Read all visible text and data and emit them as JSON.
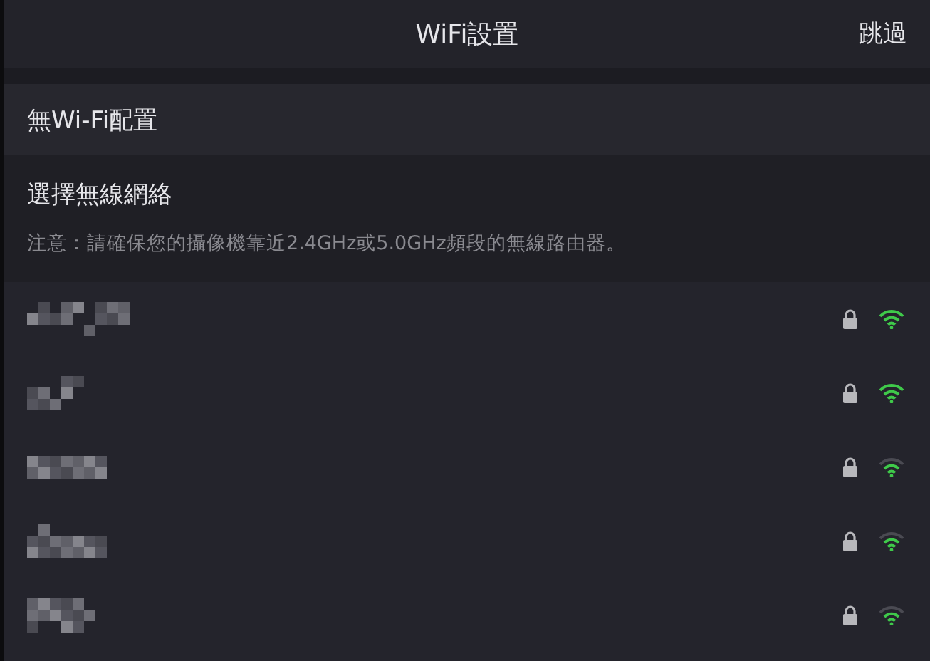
{
  "header": {
    "title": "WiFi設置",
    "skip": "跳過"
  },
  "no_wifi": {
    "label": "無Wi-Fi配置"
  },
  "section": {
    "title": "選擇無線網絡",
    "note": "注意：請確保您的攝像機靠近2.4GHz或5.0GHz頻段的無線路由器。"
  },
  "networks": [
    {
      "locked": true,
      "kind": "full"
    },
    {
      "locked": true,
      "kind": "full"
    },
    {
      "locked": true,
      "kind": "good"
    },
    {
      "locked": true,
      "kind": "good"
    },
    {
      "locked": true,
      "kind": "good"
    }
  ]
}
